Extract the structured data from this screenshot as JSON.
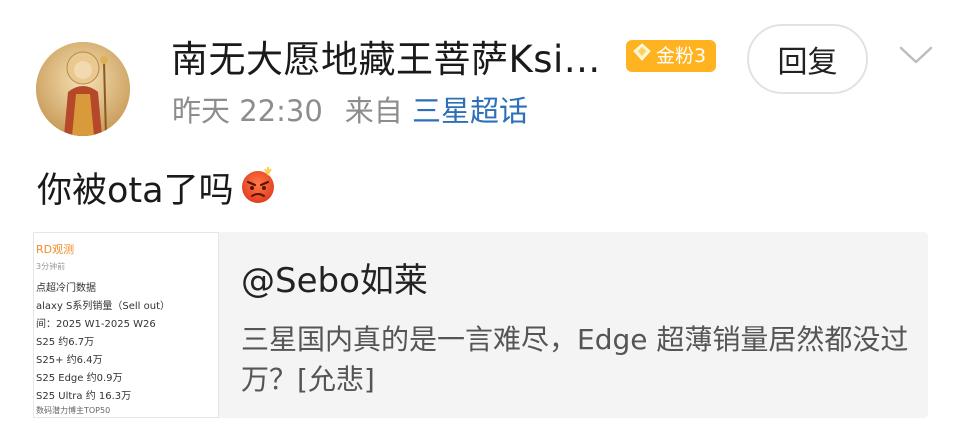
{
  "post": {
    "username": "南无大愿地藏王菩萨Ksi...",
    "badge": "金粉3",
    "reply_label": "回复",
    "time": "昨天 22:30",
    "source_prefix": "来自",
    "source_name": "三星超话",
    "text": "你被ota了吗",
    "emoji": "angry-face-emoji"
  },
  "quote": {
    "author": "@Sebo如莱",
    "text": "三星国内真的是一言难尽，Edge 超薄销量居然都没过万？[允悲]",
    "thumbnail": {
      "name": "RD观测",
      "time": "3分钟前",
      "lines": [
        "点超冷门数据",
        "alaxy S系列销量（Sell out）",
        "间：2025 W1-2025 W26",
        "S25 约6.7万",
        "S25+ 约6.4万",
        "S25 Edge 约0.9万",
        "S25 Ultra 约 16.3万"
      ],
      "footer": "数码潜力博主TOP50"
    }
  },
  "colors": {
    "badge": "#ffb320",
    "link": "#2d6fb8",
    "meta": "#8d8d8d",
    "quote_bg": "#f4f4f4"
  }
}
